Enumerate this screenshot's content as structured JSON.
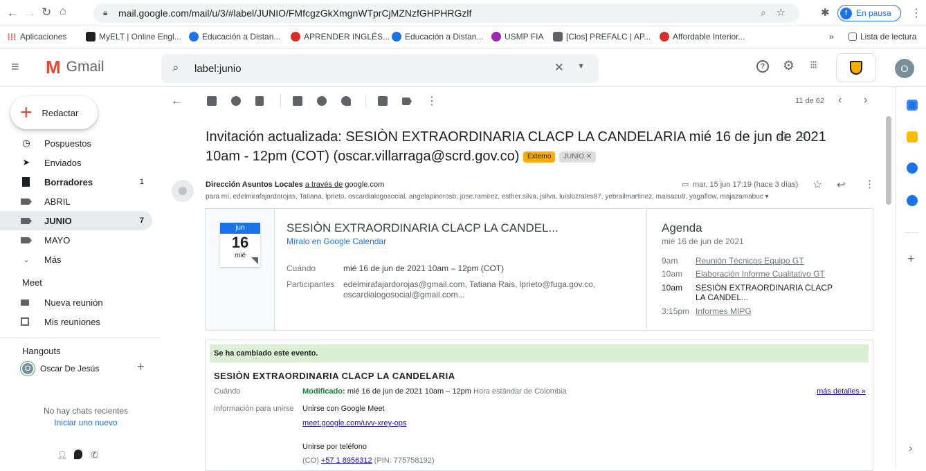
{
  "browser": {
    "url": "mail.google.com/mail/u/3/#label/JUNIO/FMfcgzGkXmgnWTprCjMZNzfGHPHRGzlf",
    "profile_initial": "f",
    "profile_status": "En pausa",
    "bookmarks": [
      {
        "label": "Aplicaciones",
        "color": "#ea4335"
      },
      {
        "label": "MyELT | Online Engl...",
        "color": "#202124"
      },
      {
        "label": "Educación a Distan...",
        "color": "#1a73e8"
      },
      {
        "label": "APRENDER INGLÉS...",
        "color": "#d93025"
      },
      {
        "label": "Educación a Distan...",
        "color": "#1a73e8"
      },
      {
        "label": "USMP FIA",
        "color": "#9c27b0"
      },
      {
        "label": "[Clos] PREFALC | AP...",
        "color": "#5f6368"
      },
      {
        "label": "Affordable Interior...",
        "color": "#d93025"
      }
    ],
    "more_bookmarks": "»",
    "reading_list": "Lista de lectura"
  },
  "gmail": {
    "logo_text": "Gmail",
    "search_value": "label:junio",
    "account_initial": "O",
    "compose": "Redactar",
    "nav": [
      {
        "label": "Pospuestos",
        "count": ""
      },
      {
        "label": "Enviados",
        "count": ""
      },
      {
        "label": "Borradores",
        "count": "1"
      },
      {
        "label": "ABRIL",
        "count": ""
      },
      {
        "label": "JUNIO",
        "count": "7"
      },
      {
        "label": "MAYO",
        "count": ""
      },
      {
        "label": "Más",
        "count": ""
      }
    ],
    "meet_title": "Meet",
    "meet_items": [
      "Nueva reunión",
      "Mis reuniones"
    ],
    "hangouts_title": "Hangouts",
    "hangouts_user": "Oscar De Jesús",
    "hangouts_user_initial": "O",
    "no_chats": "No hay chats recientes",
    "start_new": "Iniciar uno nuevo",
    "pagination": "11 de 62"
  },
  "email": {
    "subject": "Invitación actualizada: SESIÒN EXTRAORDINARIA CLACP LA CANDELARIA mié 16 de jun de 2021 10am - 12pm (COT) (oscar.villarraga@scrd.gov.co)",
    "chip_external": "Externo",
    "chip_label": "JUNIO",
    "sender": "Dirección Asuntos Locales",
    "via": "a través de",
    "via_domain": "google.com",
    "date": "mar, 15 jun 17:19 (hace 3 días)",
    "recipients": "para mí, edelmirafajardorojas, Tatiana, lprieto, oscardialogosocial, angelapinerosb, jose.ramirez, esther.silva, jsilva, luislozrales87, yebrailmartinez, maisacu8, yagaflow, majazamabuc"
  },
  "card": {
    "month": "jun",
    "day": "16",
    "weekday": "mié",
    "title": "SESIÒN EXTRAORDINARIA CLACP LA CANDEL...",
    "calendar_link": "Míralo en Google Calendar",
    "when_label": "Cuándo",
    "when_value": "mié 16 de jun de 2021 10am – 12pm (COT)",
    "participants_label": "Participantes",
    "participants_value": "edelmirafajardorojas@gmail.com, Tatiana Rais, lprieto@fuga.gov.co, oscardialogosocial@gmail.com...",
    "agenda_title": "Agenda",
    "agenda_date": "mié 16 de jun de 2021",
    "agenda": [
      {
        "time": "9am",
        "text": "Reunión Técnicos Equipo GT"
      },
      {
        "time": "10am",
        "text": "Elaboración Informe Cualitativo GT"
      },
      {
        "time": "10am",
        "text": "SESIÒN EXTRAORDINARIA CLACP LA CANDEL..."
      },
      {
        "time": "3:15pm",
        "text": "Informes MIPG"
      }
    ]
  },
  "body": {
    "changed_banner": "Se ha cambiado este evento.",
    "event_title": "SESIÒN EXTRAORDINARIA CLACP LA CANDELARIA",
    "when_label": "Cuándo",
    "modified": "Modificado:",
    "when_value": "mié 16 de jun de 2021 10am – 12pm",
    "timezone": "Hora estándar de Colombia",
    "more_details": "más detalles »",
    "join_label": "Información para unirse",
    "join_meet": "Unirse con Google Meet",
    "meet_link": "meet.google.com/uvv-xrey-ops",
    "join_phone": "Unirse por teléfono",
    "phone_prefix": "(CO)",
    "phone": "+57 1 8956312",
    "pin": "(PIN: 775758192)"
  },
  "colors": {
    "external_chip": "#f9ab00",
    "banner_green": "#d9f0d3",
    "active_nav": "#e8eaed",
    "link_blue": "#1a0dab"
  }
}
